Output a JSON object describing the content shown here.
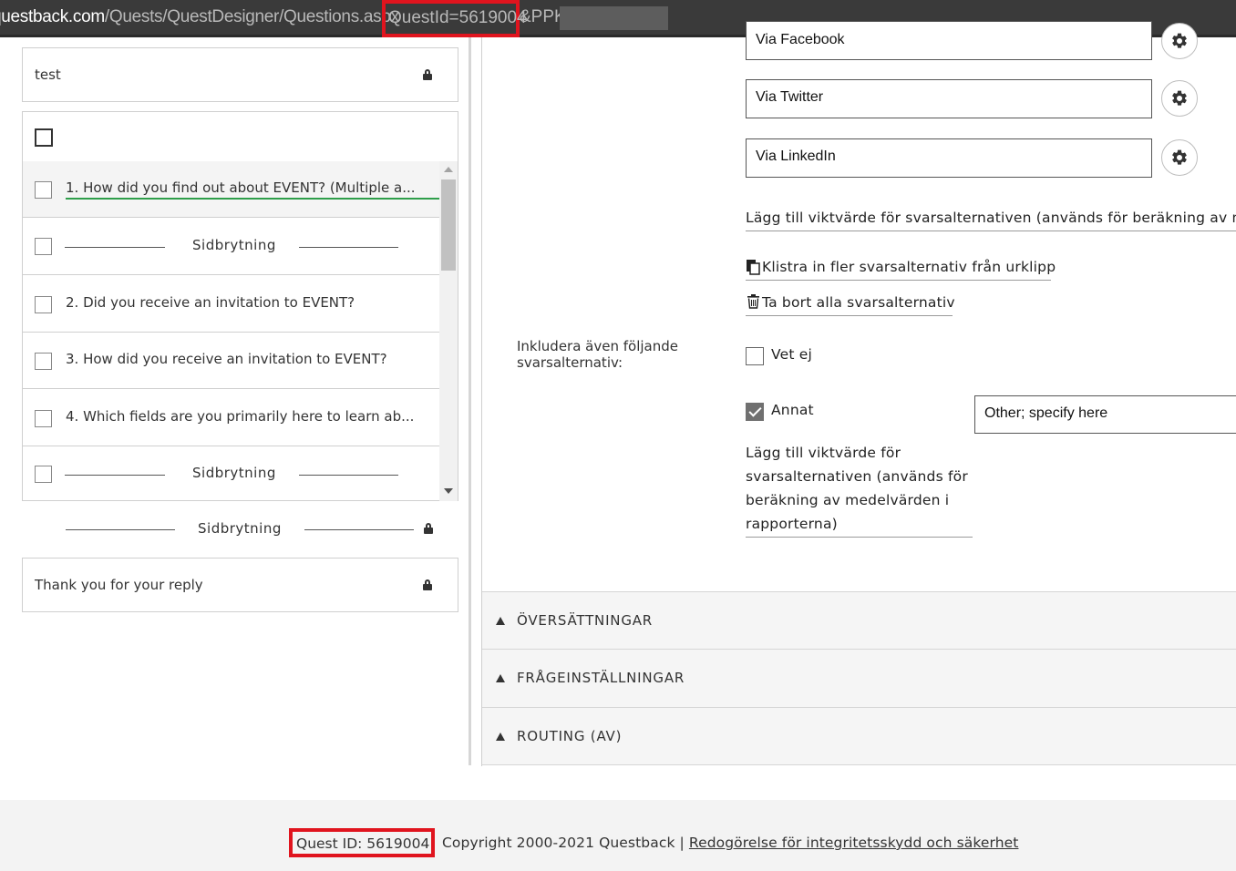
{
  "browser": {
    "url_domain": "questback.com",
    "url_path": "/Quests/QuestDesigner/Questions.aspx",
    "url_param_highlighted": "QuestId=5619004",
    "url_rest": "&PPK="
  },
  "left": {
    "intro_label": "test",
    "questions": [
      {
        "label": "1.  How did you find out about EVENT? (Multiple a...",
        "selected": true
      },
      {
        "label": "2.  Did you receive an invitation to EVENT?"
      },
      {
        "label": "3.  How did you receive an invitation to EVENT?"
      },
      {
        "label": "4.  Which fields are you primarily here to learn ab..."
      }
    ],
    "page_break_label": "Sidbrytning",
    "locked_page_break_label": "Sidbrytning",
    "thank_you_label": "Thank you for your reply"
  },
  "right": {
    "alternatives": [
      {
        "value": "Via Facebook"
      },
      {
        "value": "Via Twitter"
      },
      {
        "value": "Via LinkedIn"
      }
    ],
    "weight_link_top": "Lägg till viktvärde för svarsalternativen (används för beräkning av m",
    "paste_link": "Klistra in fler svarsalternativ från urklipp",
    "delete_link": "Ta bort alla svarsalternativ",
    "include_label": "Inkludera även följande svarsalternativ:",
    "dont_know_label": "Vet ej",
    "dont_know_checked": false,
    "other_label": "Annat",
    "other_checked": true,
    "other_input_value": "Other; specify here",
    "weight_link_bottom": "Lägg till viktvärde för svarsalternativen (används för beräkning av medelvärden i rapporterna)",
    "sections": [
      {
        "label": "ÖVERSÄTTNINGAR"
      },
      {
        "label": "FRÅGEINSTÄLLNINGAR"
      },
      {
        "label": "ROUTING (AV)"
      }
    ]
  },
  "footer": {
    "quest_id": "Quest ID: 5619004",
    "copyright": "Copyright 2000-2021 Questback |",
    "privacy_link": "Redogörelse för integritetsskydd och säkerhet"
  },
  "colors": {
    "highlight_red": "#e0141e",
    "selected_underline": "#2e9e4a",
    "urlbar_bg": "#3a3a3a"
  }
}
